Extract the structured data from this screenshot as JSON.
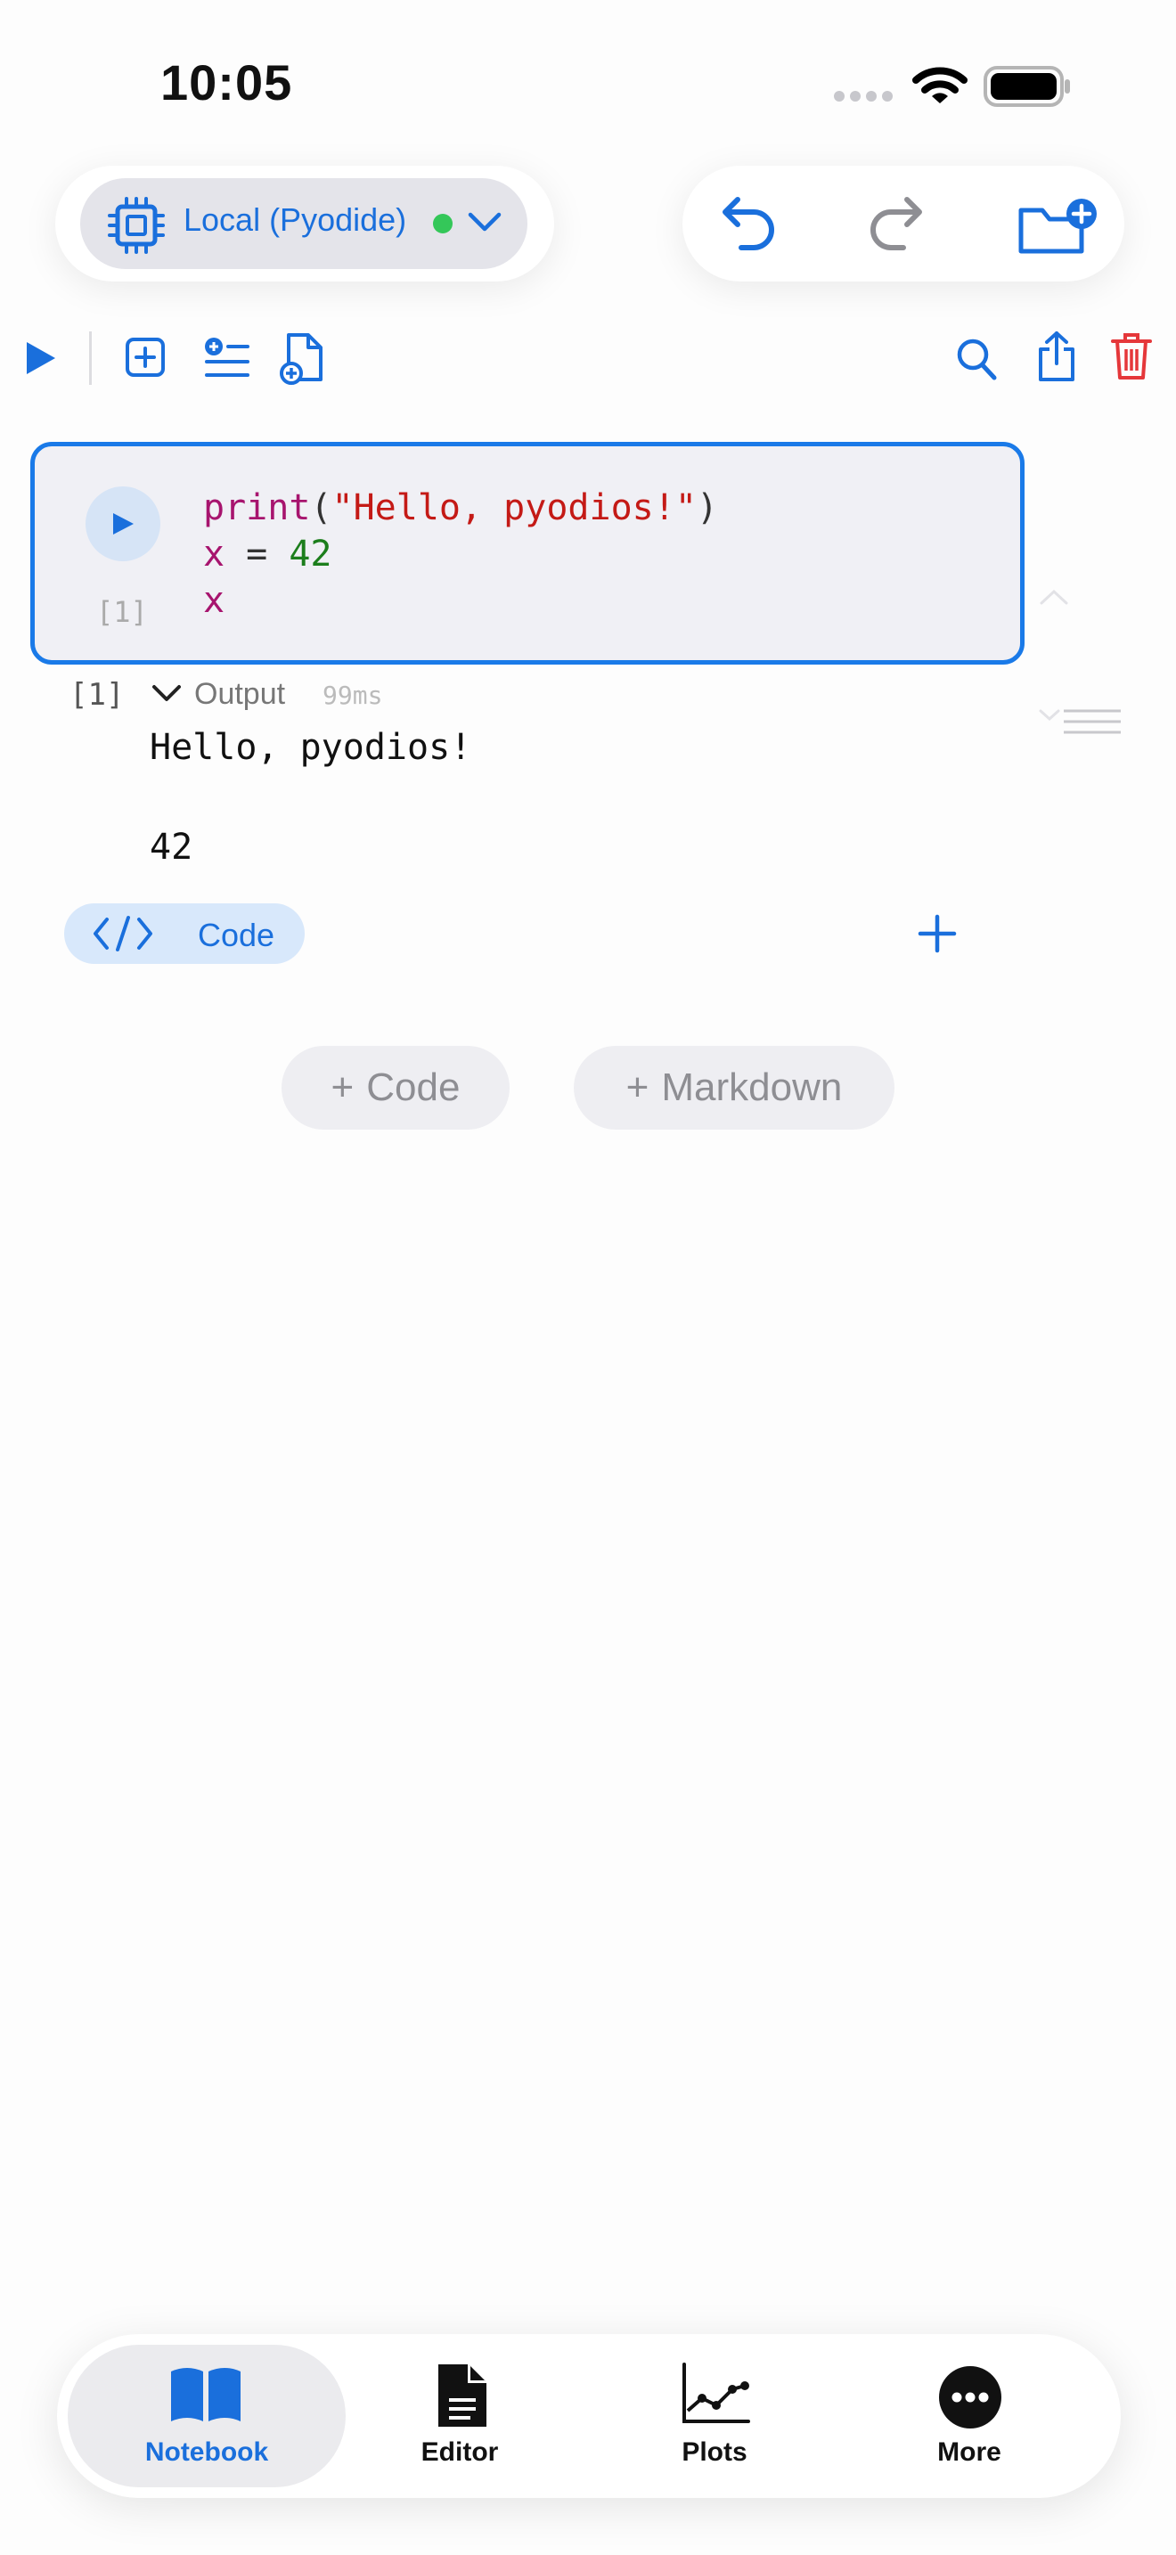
{
  "status_bar": {
    "time": "10:05"
  },
  "kernel": {
    "label": "Local (Pyodide)",
    "status_color": "#34c759"
  },
  "colors": {
    "accent": "#1a7ae8",
    "danger": "#e5373a"
  },
  "toolbar": {
    "left_icons": [
      "run-all-icon",
      "add-cell-icon",
      "insert-list-icon",
      "new-document-icon"
    ],
    "right_icons": [
      "search-icon",
      "share-icon",
      "trash-icon"
    ],
    "top_right_icons": [
      "undo-icon",
      "redo-icon",
      "new-folder-icon"
    ]
  },
  "cell": {
    "exec_count": "[1]",
    "code": {
      "l1_fn": "print",
      "l1_open": "(",
      "l1_str": "\"Hello, pyodios!\"",
      "l1_close": ")",
      "l2_var": "x",
      "l2_op": " = ",
      "l2_num": "42",
      "l3_var": "x"
    }
  },
  "output": {
    "exec_count": "[1]",
    "label": "Output",
    "duration": "99ms",
    "lines": [
      "Hello, pyodios!",
      "42"
    ]
  },
  "cell_type_chip": {
    "label": "Code"
  },
  "add_buttons": {
    "code": "Code",
    "markdown": "Markdown"
  },
  "tabs": [
    {
      "label": "Notebook",
      "icon": "book-icon",
      "active": true
    },
    {
      "label": "Editor",
      "icon": "document-icon",
      "active": false
    },
    {
      "label": "Plots",
      "icon": "chart-icon",
      "active": false
    },
    {
      "label": "More",
      "icon": "ellipsis-icon",
      "active": false
    }
  ]
}
